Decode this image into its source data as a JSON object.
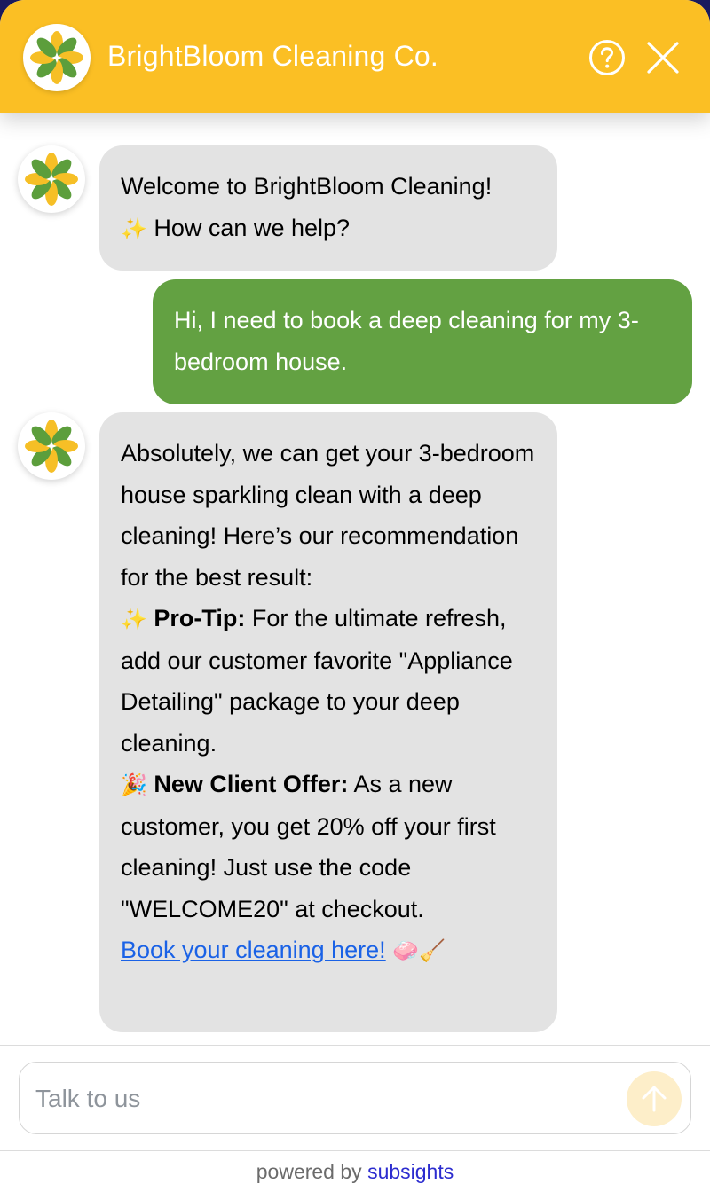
{
  "header": {
    "title": "BrightBloom Cleaning Co.",
    "logo_icon": "flower-logo-icon",
    "help_icon": "help-circle-icon",
    "close_icon": "close-icon",
    "background_color": "#fbbf24"
  },
  "messages": [
    {
      "sender": "bot",
      "line1": "Welcome to BrightBloom Cleaning!",
      "sparkle": "✨",
      "line2": "How can we help?"
    },
    {
      "sender": "user",
      "text": "Hi, I need to book a deep cleaning for my 3-bedroom house."
    },
    {
      "sender": "bot",
      "intro": "Absolutely, we can get your 3-bedroom house sparkling clean with a deep cleaning! Here’s our recommendation for the best result:",
      "tip_emoji": "✨",
      "tip_label": "Pro-Tip:",
      "tip_text": "For the ultimate refresh, add our customer favorite \"Appliance Detailing\" package to your deep cleaning.",
      "offer_emoji": "🎉",
      "offer_label": "New Client Offer:",
      "offer_text": "As a new customer, you get 20% off your first cleaning! Just use the code \"WELCOME20\" at checkout.",
      "link_text": "Book your cleaning here!",
      "link_emojis": "🧼🧹"
    }
  ],
  "composer": {
    "placeholder": "Talk to us",
    "send_icon": "arrow-up-icon"
  },
  "footer": {
    "prefix": "powered by",
    "brand": "subsights"
  },
  "colors": {
    "accent": "#fbbf24",
    "user_bubble": "#63a142",
    "bot_bubble": "#e3e3e3",
    "link": "#1a62e6"
  }
}
